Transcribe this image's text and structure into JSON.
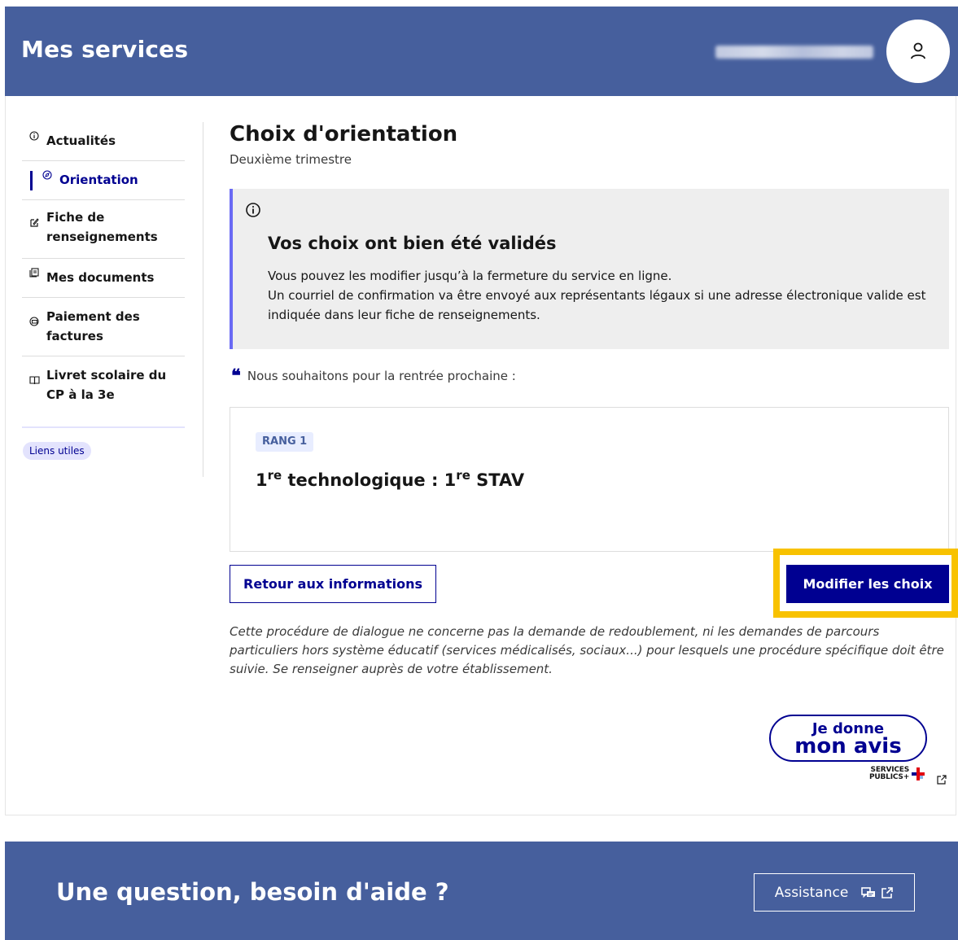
{
  "header": {
    "title": "Mes services"
  },
  "sidebar": {
    "items": [
      {
        "label": "Actualités",
        "icon": "info-icon"
      },
      {
        "label": "Orientation",
        "icon": "compass-icon",
        "active": true
      },
      {
        "label": "Fiche de renseignements",
        "icon": "edit-form-icon"
      },
      {
        "label": "Mes documents",
        "icon": "documents-icon"
      },
      {
        "label": "Paiement des factures",
        "icon": "payment-icon"
      },
      {
        "label": "Livret scolaire du CP à la 3e",
        "icon": "book-icon"
      }
    ],
    "links_label": "Liens utiles"
  },
  "main": {
    "title": "Choix d'orientation",
    "subtitle": "Deuxième trimestre",
    "alert": {
      "title": "Vos choix ont bien été validés",
      "line1": "Vous pouvez les modifier jusqu’à la fermeture du service en ligne.",
      "line2": "Un courriel de confirmation va être envoyé aux représentants légaux si une adresse électronique valide est indiquée dans leur fiche de renseignements."
    },
    "quote": "Nous souhaitons pour la rentrée prochaine :",
    "choice": {
      "rank": "RANG 1",
      "part1": "1",
      "sup1": "re",
      "part2": " technologique : 1",
      "sup2": "re",
      "part3": " STAV"
    },
    "buttons": {
      "back": "Retour aux informations",
      "modify": "Modifier les choix"
    },
    "disclaimer": "Cette procédure de dialogue ne concerne pas la demande de redoublement, ni les demandes de parcours particuliers hors système éducatif (services médicalisés, sociaux...) pour lesquels une procédure spécifique doit être suivie. Se renseigner auprès de votre établissement.",
    "feedback": {
      "line1": "Je donne",
      "line2": "mon avis",
      "brand_line1": "SERVICES",
      "brand_line2": "PUBLICS+"
    }
  },
  "footer": {
    "title": "Une question, besoin d'aide ?",
    "assistance": "Assistance"
  },
  "colors": {
    "header_bg": "#465f9d",
    "primary": "#000091",
    "highlight": "#f8c200",
    "alert_accent": "#6a6af4"
  }
}
